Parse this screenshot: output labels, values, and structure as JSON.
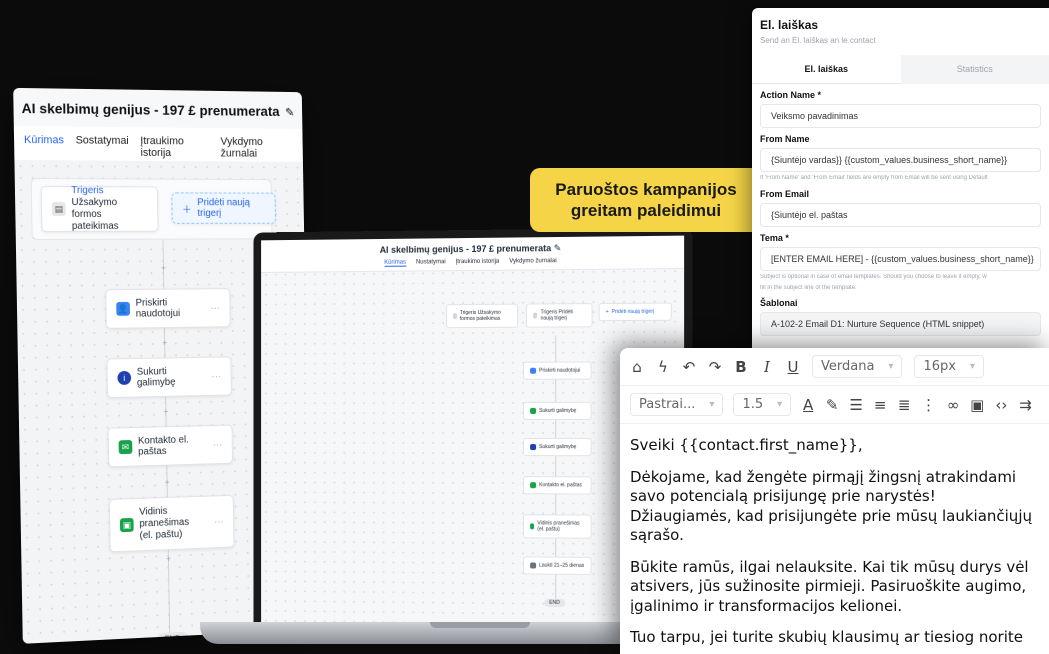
{
  "left_panel": {
    "title": "AI skelbimų genijus - 197 £ prenumerata",
    "tabs": [
      "Kūrimas",
      "Sostatymai",
      "Įtraukimo istorija",
      "Vykdymo žurnalai"
    ],
    "trigger": {
      "label": "Trigeris",
      "value": "Užsakymo formos pateikimas"
    },
    "add_trigger": "Pridėti naują trigerį",
    "steps": [
      "Priskirti naudotojui",
      "Sukurti galimybę",
      "Kontakto el. paštas",
      "Vidinis pranešimas (el. paštu)"
    ],
    "end": "END",
    "colors": {
      "assign": "#3b82f6",
      "opportunity": "#1e40af",
      "email": "#16a34a",
      "internal": "#16a34a"
    }
  },
  "laptop": {
    "title": "AI skelbimų genijus - 197 £ prenumerata",
    "tabs": [
      "Kūrimas",
      "Nustatymai",
      "Įtraukimo istorija",
      "Vykdymo žurnalai"
    ],
    "trigger1": "Trigeris Užsakymo formos pateikimas",
    "trigger2": "Trigeris Pridėti naują trigerį",
    "add_trigger": "Pridėti naują trigerį",
    "steps": [
      "Priskirti naudotojui",
      "Sukurti galimybę",
      "Sukurti galimybę",
      "Kontakto el. paštas",
      "Vidinis pranešimas (el. paštu)",
      "Laukti 21–25 dienas"
    ],
    "end": "END"
  },
  "promo": {
    "line1": "Paruoštos kampanijos",
    "line2": "greitam paleidimui"
  },
  "email_panel": {
    "title": "El. laiškas",
    "subtitle": "Send an El. laiškas an le contact",
    "tabs": [
      "El. laiškas",
      "Statistics"
    ],
    "action_name_label": "Action Name *",
    "action_name_value": "Veiksmo pavadinimas",
    "from_name_label": "From Name",
    "from_name_value": "{Siuntėjo vardas}} {{custom_values.business_short_name}}",
    "from_name_hint": "If 'From Name' and 'From Email' fields are empty from Email will be sent using Default",
    "from_email_label": "From Email",
    "from_email_value": "{Siuntėjo el. paštas",
    "subject_label": "Tema *",
    "subject_value": "[ENTER EMAIL HERE] - {{custom_values.business_short_name}}",
    "subject_hint1": "Subject is optional in case of email templates. Should you choose to leave it empty, w",
    "subject_hint2": "fill in the subject line of the template.",
    "templates_label": "Šablonai",
    "template_value": "A-102-2 Email D1: Nurture Sequence (HTML snippet)"
  },
  "editor": {
    "font": "Verdana",
    "size": "16px",
    "block": "Pastrai...",
    "line_height": "1.5",
    "paragraphs": [
      "Sveiki {{contact.first_name}},",
      "Dėkojame, kad žengėte pirmąjį žingsnį atrakindami savo potencialą prisijungę prie narystės! Džiaugiamės, kad prisijungėte prie mūsų laukiančiųjų sąrašo.",
      "Būkite ramūs, ilgai nelauksite. Kai tik mūsų durys vėl atsivers, jūs sužinosite pirmieji. Pasiruoškite augimo, įgalinimo ir transformacijos kelionei.",
      "Tuo tarpu, jei turite skubių klausimų ar tiesiog norite"
    ]
  }
}
